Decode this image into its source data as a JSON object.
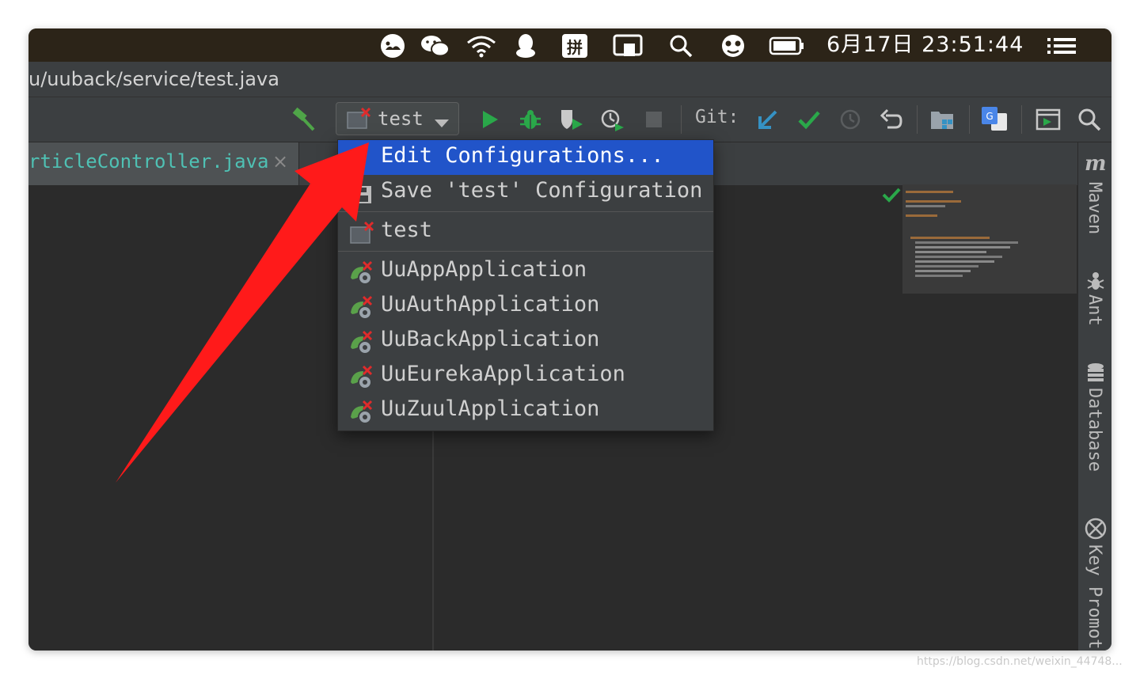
{
  "menubar": {
    "clock": "6月17日  23:51:44",
    "icons": [
      "app-status-icon",
      "wechat-icon",
      "wifi-icon",
      "qq-icon",
      "input-method-icon",
      "airplay-icon",
      "spotlight-search-icon",
      "avatar-icon",
      "battery-icon",
      "menu-list-icon"
    ],
    "input_method_label": "拼"
  },
  "titlebar": {
    "path": "u/uuback/service/test.java"
  },
  "toolbar": {
    "run_config_label": "test",
    "git_label": "Git:",
    "colors": {
      "run": "#2aa84a",
      "git_update": "#3592c4",
      "git_commit": "#2aa84a",
      "config_error": "#e02b2b"
    }
  },
  "editor": {
    "tab_label": "rticleController.java",
    "tab_close": "×"
  },
  "run_popup": {
    "items": [
      {
        "label": "Edit Configurations...",
        "selected": true
      },
      {
        "label": "Save 'test' Configuration"
      },
      {
        "label": "test"
      },
      {
        "label": "UuAppApplication"
      },
      {
        "label": "UuAuthApplication"
      },
      {
        "label": "UuBackApplication"
      },
      {
        "label": "UuEurekaApplication"
      },
      {
        "label": "UuZuulApplication"
      }
    ],
    "highlight_color": "#2154c9"
  },
  "rightbar": {
    "maven_icon_text": "m",
    "maven": "Maven",
    "ant": "Ant",
    "database": "Database",
    "key_promoter": "Key Promot"
  },
  "annotation": {
    "arrow_color": "#ff1a1a"
  },
  "watermark": "https://blog.csdn.net/weixin_44748..."
}
